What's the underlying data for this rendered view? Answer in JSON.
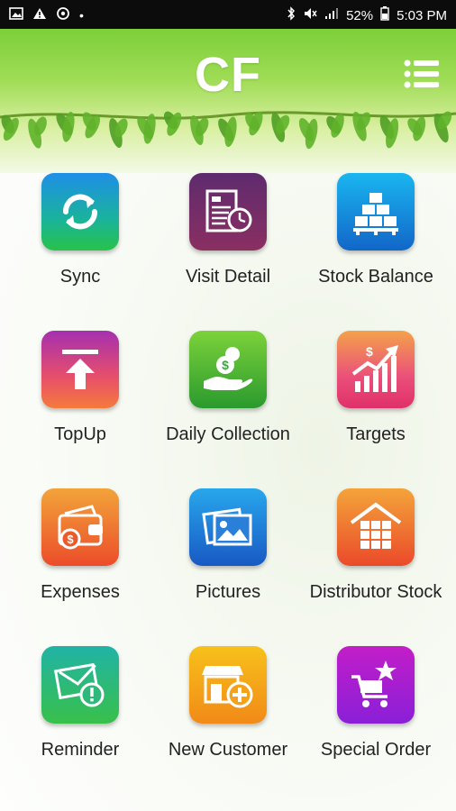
{
  "status_bar": {
    "battery": "52%",
    "time": "5:03 PM"
  },
  "header": {
    "title": "CF"
  },
  "tiles": [
    {
      "label": "Sync",
      "icon": "sync-icon"
    },
    {
      "label": "Visit Detail",
      "icon": "visit-detail-icon"
    },
    {
      "label": "Stock Balance",
      "icon": "stock-balance-icon"
    },
    {
      "label": "TopUp",
      "icon": "topup-icon"
    },
    {
      "label": "Daily Collection",
      "icon": "daily-collection-icon"
    },
    {
      "label": "Targets",
      "icon": "targets-icon"
    },
    {
      "label": "Expenses",
      "icon": "expenses-icon"
    },
    {
      "label": "Pictures",
      "icon": "pictures-icon"
    },
    {
      "label": "Distributor Stock",
      "icon": "distributor-stock-icon"
    },
    {
      "label": "Reminder",
      "icon": "reminder-icon"
    },
    {
      "label": "New Customer",
      "icon": "new-customer-icon"
    },
    {
      "label": "Special Order",
      "icon": "special-order-icon"
    }
  ],
  "colors": {
    "header_green": "#7dcf3a",
    "leaf_green": "#5fb32a"
  }
}
